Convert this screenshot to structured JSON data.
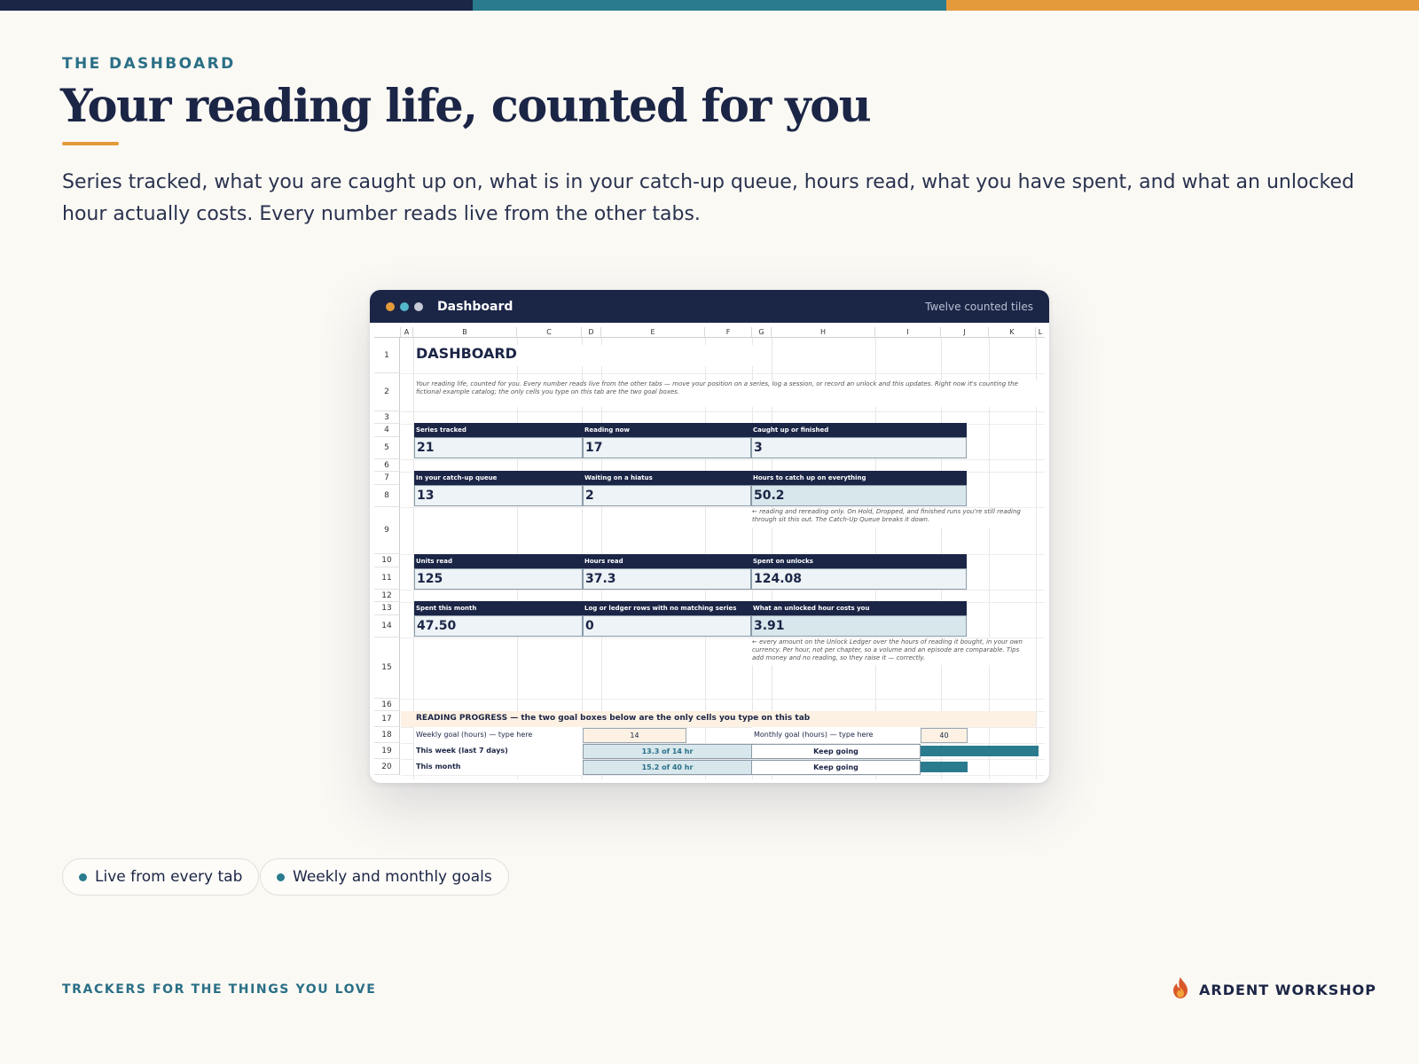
{
  "colors": {
    "navy": "#1b2546",
    "teal": "#2a7b8e",
    "orange": "#e49a3b",
    "background": "#fbf9f4"
  },
  "hero": {
    "eyebrow": "THE DASHBOARD",
    "headline": "Your reading life, counted for you",
    "lede": "Series tracked, what you are caught up on, what is in your catch-up queue, hours read, what you have spent, and what an unlocked hour actually costs. Every number reads live from the other tabs."
  },
  "window": {
    "title": "Dashboard",
    "subtitle": "Twelve counted tiles",
    "dot_icons": [
      "orange-dot-icon",
      "teal-dot-icon",
      "gray-dot-icon"
    ]
  },
  "sheet": {
    "columns": [
      "A",
      "B",
      "C",
      "D",
      "E",
      "F",
      "G",
      "H",
      "I",
      "J",
      "K",
      "L"
    ],
    "rows": [
      "1",
      "2",
      "3",
      "4",
      "5",
      "6",
      "7",
      "8",
      "9",
      "10",
      "11",
      "12",
      "13",
      "14",
      "15",
      "16",
      "17",
      "18",
      "19",
      "20"
    ],
    "title": "DASHBOARD",
    "intro": "Your reading life, counted for you. Every number reads live from the other tabs — move your position on a series, log a session, or record an unlock and this updates. Right now it's counting the fictional example catalog; the only cells you type on this tab are the two goal boxes.",
    "tiles": [
      {
        "label": "Series tracked",
        "value": "21"
      },
      {
        "label": "Reading now",
        "value": "17"
      },
      {
        "label": "Caught up or finished",
        "value": "3"
      },
      {
        "label": "In your catch-up queue",
        "value": "13"
      },
      {
        "label": "Waiting on a hiatus",
        "value": "2"
      },
      {
        "label": "Hours to catch up on everything",
        "value": "50.2"
      },
      {
        "label": "Units read",
        "value": "125"
      },
      {
        "label": "Hours read",
        "value": "37.3"
      },
      {
        "label": "Spent on unlocks",
        "value": "124.08"
      },
      {
        "label": "Spent this month",
        "value": "47.50"
      },
      {
        "label": "Log or ledger rows with no matching series",
        "value": "0"
      },
      {
        "label": "What an unlocked hour costs you",
        "value": "3.91"
      }
    ],
    "note_hours": "← reading and rereading only. On Hold, Dropped, and finished runs you're still reading through sit this out. The Catch-Up Queue breaks it down.",
    "note_cost": "← every amount on the Unlock Ledger over the hours of reading it bought, in your own currency. Per hour, not per chapter, so a volume and an episode are comparable. Tips add money and no reading, so they raise it — correctly.",
    "progress": {
      "header": "READING PROGRESS  —  the two goal boxes below are the only cells you type on this tab",
      "weekly_label": "Weekly goal (hours) — type here",
      "weekly_goal": "14",
      "monthly_label": "Monthly goal (hours) — type here",
      "monthly_goal": "40",
      "week_label": "This week (last 7 days)",
      "week_value": "13.3 of 14 hr",
      "week_status": "Keep going",
      "week_fraction": 0.95,
      "month_label": "This month",
      "month_value": "15.2 of 40 hr",
      "month_status": "Keep going",
      "month_fraction": 0.38
    }
  },
  "pills": [
    "Live from every tab",
    "Weekly and monthly goals"
  ],
  "footer": {
    "tagline": "TRACKERS FOR THE THINGS YOU LOVE",
    "brand": "ARDENT WORKSHOP",
    "brand_icon": "flame-icon"
  }
}
